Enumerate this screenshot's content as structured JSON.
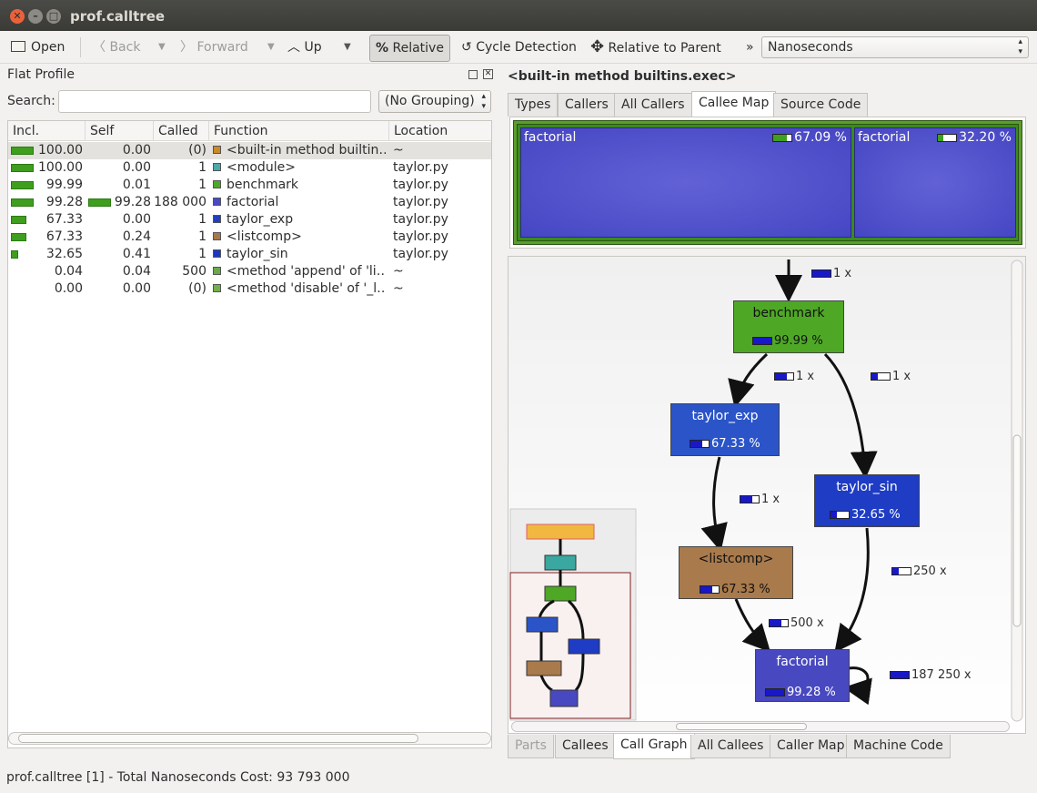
{
  "window": {
    "title": "prof.calltree"
  },
  "toolbar": {
    "open": "Open",
    "back": "Back",
    "forward": "Forward",
    "up": "Up",
    "relative": "Relative",
    "cycle": "Cycle Detection",
    "relparent": "Relative to Parent",
    "more": "»",
    "event_type": "Nanoseconds"
  },
  "flat": {
    "title": "Flat Profile",
    "search_label": "Search:",
    "search_value": "",
    "grouping": "(No Grouping)",
    "columns": [
      "Incl.",
      "Self",
      "Called",
      "Function",
      "Location"
    ],
    "rows": [
      {
        "incl": "100.00",
        "self": "0.00",
        "called": "(0)",
        "func": "<built-in method builtin…",
        "loc": "~",
        "incl_frac": 1.0,
        "self_frac": 0,
        "color": "#c98a28"
      },
      {
        "incl": "100.00",
        "self": "0.00",
        "called": "1",
        "func": "<module>",
        "loc": "taylor.py",
        "incl_frac": 1.0,
        "self_frac": 0,
        "color": "#4aa9a9"
      },
      {
        "incl": "99.99",
        "self": "0.01",
        "called": "1",
        "func": "benchmark",
        "loc": "taylor.py",
        "incl_frac": 0.9999,
        "self_frac": 0,
        "color": "#4ea826"
      },
      {
        "incl": "99.28",
        "self": "99.28",
        "called": "188 000",
        "func": "factorial",
        "loc": "taylor.py",
        "incl_frac": 0.9928,
        "self_frac": 0.9928,
        "color": "#4848c8"
      },
      {
        "incl": "67.33",
        "self": "0.00",
        "called": "1",
        "func": "taylor_exp",
        "loc": "taylor.py",
        "incl_frac": 0.6733,
        "self_frac": 0,
        "color": "#2040c0"
      },
      {
        "incl": "67.33",
        "self": "0.24",
        "called": "1",
        "func": "<listcomp>",
        "loc": "taylor.py",
        "incl_frac": 0.6733,
        "self_frac": 0,
        "color": "#a8784c"
      },
      {
        "incl": "32.65",
        "self": "0.41",
        "called": "1",
        "func": "taylor_sin",
        "loc": "taylor.py",
        "incl_frac": 0.3265,
        "self_frac": 0,
        "color": "#1838c0"
      },
      {
        "incl": "0.04",
        "self": "0.04",
        "called": "500",
        "func": "<method 'append' of 'li…",
        "loc": "~",
        "incl_frac": 0,
        "self_frac": 0,
        "color": "#6aa84a"
      },
      {
        "incl": "0.00",
        "self": "0.00",
        "called": "(0)",
        "func": "<method 'disable' of '_l…",
        "loc": "~",
        "incl_frac": 0,
        "self_frac": 0,
        "color": "#74b04a"
      }
    ]
  },
  "detail": {
    "title": "<built-in method builtins.exec>",
    "top_tabs": [
      "Types",
      "Callers",
      "All Callers",
      "Callee Map",
      "Source Code"
    ],
    "bottom_tabs": [
      "Parts",
      "Callees",
      "Call Graph",
      "All Callees",
      "Caller Map",
      "Machine Code"
    ]
  },
  "treemap": {
    "left": {
      "label": "factorial",
      "pct": "67.09 %",
      "frac": 0.67
    },
    "right": {
      "label": "factorial",
      "pct": "32.20 %",
      "frac": 0.32
    }
  },
  "graph": {
    "nodes": {
      "benchmark": {
        "label": "benchmark",
        "pct": "99.99 %",
        "frac": 1.0
      },
      "taylor_exp": {
        "label": "taylor_exp",
        "pct": "67.33 %",
        "frac": 0.67
      },
      "taylor_sin": {
        "label": "taylor_sin",
        "pct": "32.65 %",
        "frac": 0.33
      },
      "listcomp": {
        "label": "<listcomp>",
        "pct": "67.33 %",
        "frac": 0.67
      },
      "factorial": {
        "label": "factorial",
        "pct": "99.28 %",
        "frac": 0.99
      }
    },
    "edges": {
      "top": {
        "calls": "1 x",
        "frac": 1.0
      },
      "bench_exp": {
        "calls": "1 x",
        "frac": 0.67
      },
      "bench_sin": {
        "calls": "1 x",
        "frac": 0.33
      },
      "exp_list": {
        "calls": "1 x",
        "frac": 0.67
      },
      "sin_fact": {
        "calls": "250 x",
        "frac": 0.33
      },
      "list_fact": {
        "calls": "500 x",
        "frac": 0.67
      },
      "fact_self": {
        "calls": "187 250 x",
        "frac": 1.0
      }
    }
  },
  "status": "prof.calltree [1] - Total Nanoseconds Cost: 93 793 000"
}
